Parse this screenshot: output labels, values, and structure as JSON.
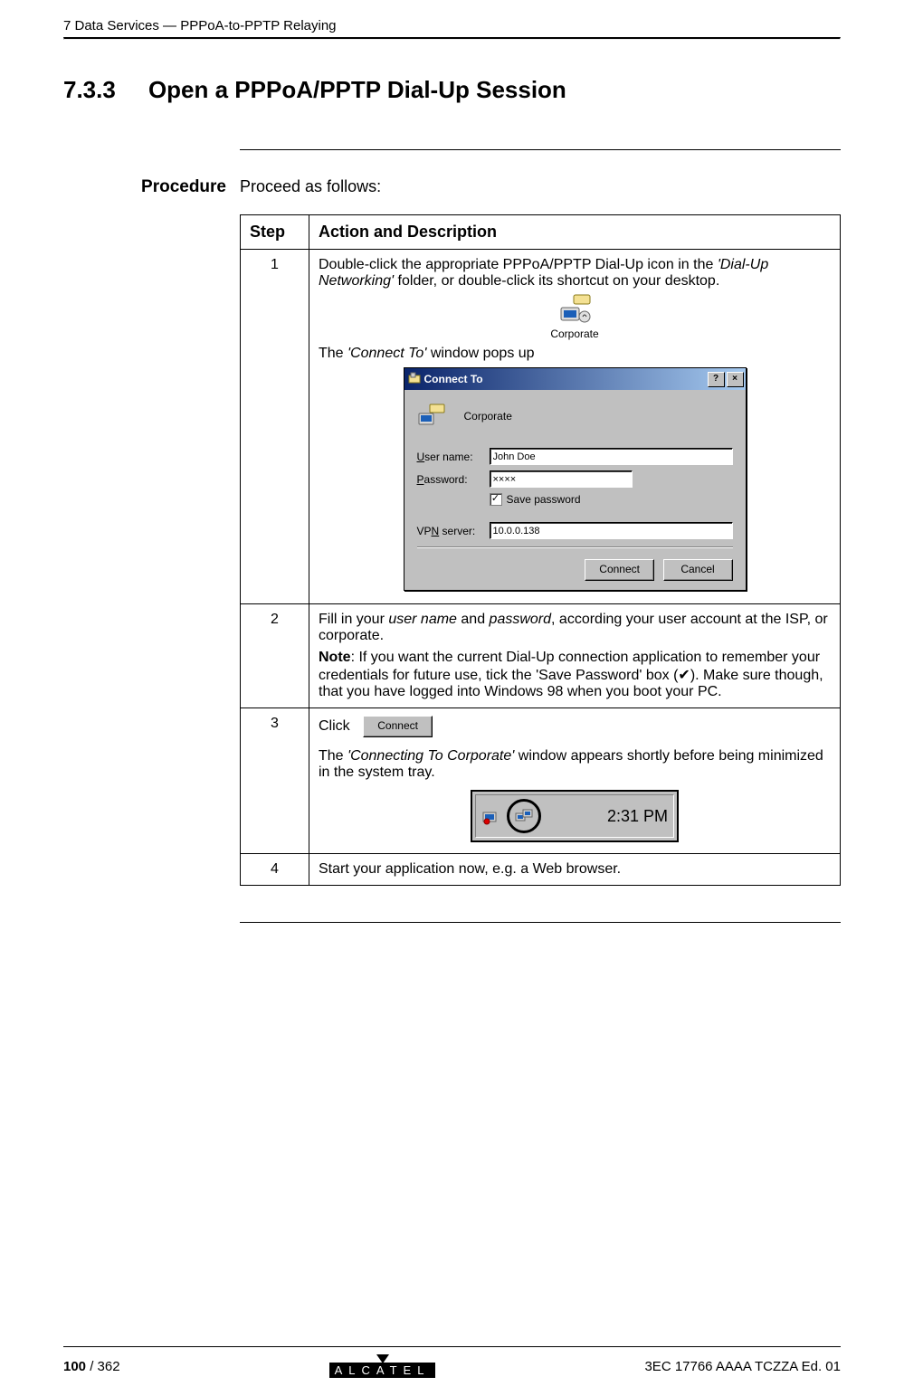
{
  "header": {
    "chapter": "7   Data Services — PPPoA-to-PPTP Relaying"
  },
  "section": {
    "number": "7.3.3",
    "title": "Open a PPPoA/PPTP Dial-Up Session"
  },
  "side_label": "Procedure",
  "intro": "Proceed as follows:",
  "table": {
    "headers": {
      "step": "Step",
      "action": "Action and Description"
    },
    "rows": [
      {
        "num": "1",
        "text1a": "Double-click the appropriate PPPoA/PPTP Dial-Up icon in the ",
        "text1b_italic": "'Dial-Up Networking'",
        "text1c": " folder, or double-click its shortcut on your desktop.",
        "icon_label": "Corporate",
        "text2a": "The ",
        "text2b_italic": "'Connect To'",
        "text2c": " window pops up",
        "dialog": {
          "title": "Connect To",
          "conn_name": "Corporate",
          "user_label_u": "U",
          "user_label_rest": "ser name:",
          "user_value": "John Doe",
          "pass_label_u": "P",
          "pass_label_rest": "assword:",
          "pass_value": "××××",
          "save_checked": "✓",
          "save_label_u": "S",
          "save_label_rest": "ave password",
          "vpn_label_u": "N",
          "vpn_label_pre": "VP",
          "vpn_label_post": " server:",
          "vpn_value": "10.0.0.138",
          "btn_connect": "Connect",
          "btn_cancel": "Cancel"
        }
      },
      {
        "num": "2",
        "text1a": "Fill in your ",
        "text1b_italic": "user name",
        "text1c": " and ",
        "text1d_italic": "password",
        "text1e": ", according your user account at the ISP, or corporate.",
        "note_label": "Note",
        "note_text": ": If you want the current Dial-Up connection application to remember your credentials for future use, tick the 'Save Password' box (✔). Make sure though, that you have logged into Windows 98 when you boot your PC."
      },
      {
        "num": "3",
        "text1": "Click",
        "btn_label": "Connect",
        "text2a": "The ",
        "text2b_italic": "'Connecting To Corporate'",
        "text2c": " window appears shortly before being minimized in the system tray.",
        "tray_time": "2:31 PM"
      },
      {
        "num": "4",
        "text": "Start your application now, e.g. a Web browser."
      }
    ]
  },
  "footer": {
    "page_bold": "100",
    "page_rest": " / 362",
    "logo_text": "ALCATEL",
    "doc_id": "3EC 17766 AAAA TCZZA Ed. 01"
  }
}
